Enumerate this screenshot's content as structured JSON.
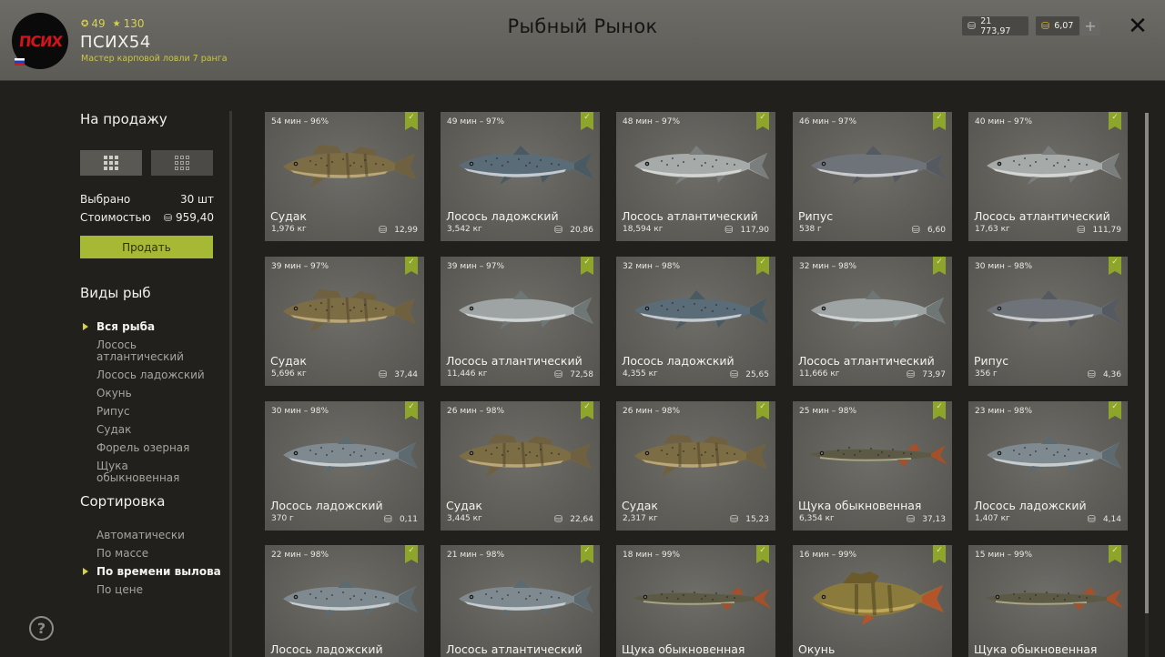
{
  "header": {
    "title": "Рыбный Рынок",
    "avatar_text": "ПСИХ",
    "username": "ПСИХ54",
    "rank": "Мастер карповой ловли 7 ранга",
    "level": "49",
    "stars": "130",
    "silver": "21 773,97",
    "gold": "6,07",
    "plus_label": "+",
    "close_label": "✕"
  },
  "sidebar": {
    "sale_title": "На продажу",
    "selected_label": "Выбрано",
    "selected_value": "30 шт",
    "cost_label": "Стоимостью",
    "cost_value": "959,40",
    "sell_button": "Продать",
    "species_title": "Виды рыб",
    "species": [
      {
        "label": "Вся рыба",
        "active": true
      },
      {
        "label": "Лосось атлантический",
        "active": false
      },
      {
        "label": "Лосось ладожский",
        "active": false
      },
      {
        "label": "Окунь",
        "active": false
      },
      {
        "label": "Рипус",
        "active": false
      },
      {
        "label": "Судак",
        "active": false
      },
      {
        "label": "Форель озерная",
        "active": false
      },
      {
        "label": "Щука обыкновенная",
        "active": false
      }
    ],
    "sort_title": "Сортировка",
    "sort": [
      {
        "label": "Автоматически",
        "active": false
      },
      {
        "label": "По массе",
        "active": false
      },
      {
        "label": "По времени вылова",
        "active": true
      },
      {
        "label": "По цене",
        "active": false
      }
    ],
    "help_label": "?"
  },
  "colors": {
    "accent": "#a7b834",
    "bookmark": "#8da52b",
    "highlight_text": "#d8d24a"
  },
  "fish": [
    {
      "meta": "54 мин – 96%",
      "name": "Судак",
      "weight": "1,976 кг",
      "price": "12,99",
      "species": "zander"
    },
    {
      "meta": "49 мин – 97%",
      "name": "Лосось ладожский",
      "weight": "3,542 кг",
      "price": "20,86",
      "species": "salmon-blue"
    },
    {
      "meta": "48 мин – 97%",
      "name": "Лосось атлантический",
      "weight": "18,594 кг",
      "price": "117,90",
      "species": "salmon-atlantic"
    },
    {
      "meta": "46 мин – 97%",
      "name": "Рипус",
      "weight": "538 г",
      "price": "6,60",
      "species": "ripus"
    },
    {
      "meta": "40 мин – 97%",
      "name": "Лосось атлантический",
      "weight": "17,63 кг",
      "price": "111,79",
      "species": "salmon-atlantic"
    },
    {
      "meta": "39 мин – 97%",
      "name": "Судак",
      "weight": "5,696 кг",
      "price": "37,44",
      "species": "zander"
    },
    {
      "meta": "39 мин – 97%",
      "name": "Лосось атлантический",
      "weight": "11,446 кг",
      "price": "72,58",
      "species": "salmon-plain"
    },
    {
      "meta": "32 мин – 98%",
      "name": "Лосось ладожский",
      "weight": "4,355 кг",
      "price": "25,65",
      "species": "salmon-blue"
    },
    {
      "meta": "32 мин – 98%",
      "name": "Лосось атлантический",
      "weight": "11,666 кг",
      "price": "73,97",
      "species": "salmon-plain"
    },
    {
      "meta": "30 мин – 98%",
      "name": "Рипус",
      "weight": "356 г",
      "price": "4,36",
      "species": "ripus"
    },
    {
      "meta": "30 мин – 98%",
      "name": "Лосось ладожский",
      "weight": "370 г",
      "price": "0,11",
      "species": "salmon-small"
    },
    {
      "meta": "26 мин – 98%",
      "name": "Судак",
      "weight": "3,445 кг",
      "price": "22,64",
      "species": "zander"
    },
    {
      "meta": "26 мин – 98%",
      "name": "Судак",
      "weight": "2,317 кг",
      "price": "15,23",
      "species": "zander"
    },
    {
      "meta": "25 мин – 98%",
      "name": "Щука обыкновенная",
      "weight": "6,354 кг",
      "price": "37,13",
      "species": "pike"
    },
    {
      "meta": "23 мин – 98%",
      "name": "Лосось ладожский",
      "weight": "1,407 кг",
      "price": "4,14",
      "species": "salmon-small"
    },
    {
      "meta": "22 мин – 98%",
      "name": "Лосось ладожский",
      "weight": "",
      "price": "",
      "species": "salmon-small"
    },
    {
      "meta": "21 мин – 98%",
      "name": "Лосось атлантический",
      "weight": "",
      "price": "",
      "species": "salmon-small"
    },
    {
      "meta": "18 мин – 99%",
      "name": "Щука обыкновенная",
      "weight": "",
      "price": "",
      "species": "pike"
    },
    {
      "meta": "16 мин – 99%",
      "name": "Окунь",
      "weight": "",
      "price": "",
      "species": "perch"
    },
    {
      "meta": "15 мин – 99%",
      "name": "Щука обыкновенная",
      "weight": "",
      "price": "",
      "species": "pike"
    }
  ]
}
